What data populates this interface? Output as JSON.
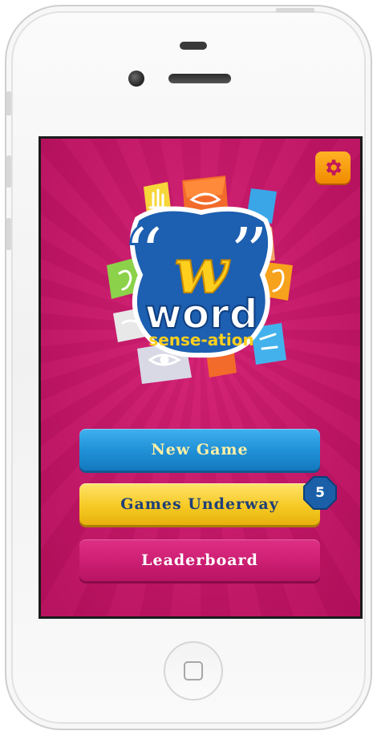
{
  "device": {
    "name": "iPhone"
  },
  "app": {
    "logo": {
      "quote_open": "“",
      "quote_close": "”",
      "letter": "w",
      "word": "word",
      "tagline": "sense-ation"
    },
    "settings_icon": "gear-icon",
    "buttons": {
      "new_game": "New Game",
      "games_underway": "Games Underway",
      "leaderboard": "Leaderboard"
    },
    "games_underway_count": "5"
  },
  "colors": {
    "background": "#c81d6d",
    "new_game": "#1f8fd6",
    "games_underway": "#f6c924",
    "leaderboard": "#cc1e72",
    "gear_button": "#f59b10",
    "badge": "#1a5fa8"
  }
}
